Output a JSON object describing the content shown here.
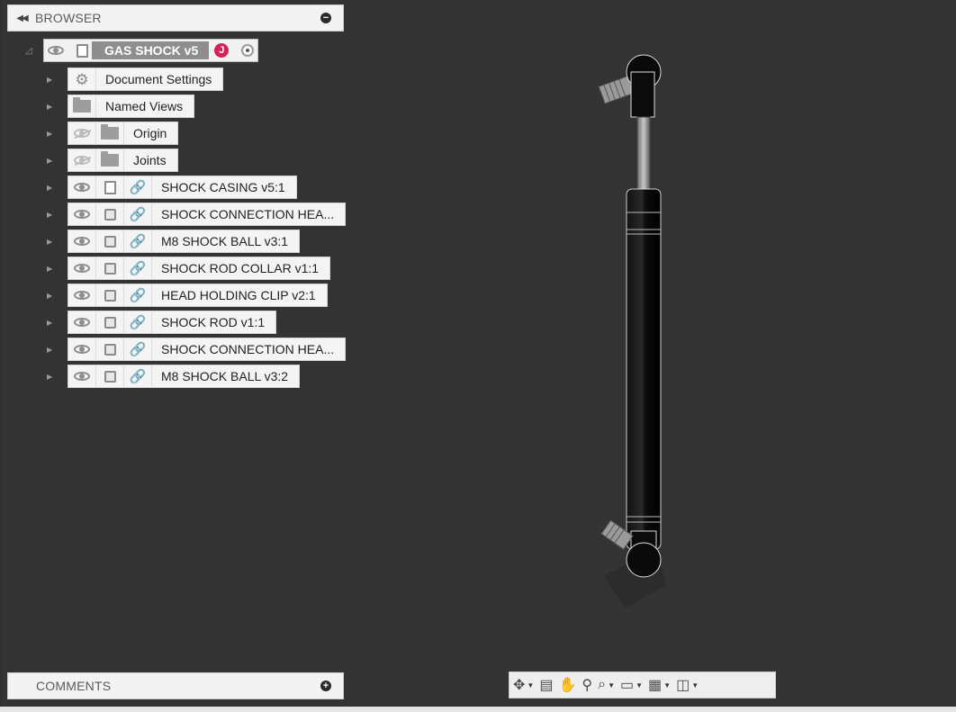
{
  "browser": {
    "title": "BROWSER"
  },
  "comments": {
    "title": "COMMENTS"
  },
  "root": {
    "title": "GAS SHOCK v5",
    "user_initial": "J"
  },
  "tree": [
    {
      "label": "Document Settings",
      "type": "settings"
    },
    {
      "label": "Named Views",
      "type": "folder"
    },
    {
      "label": "Origin",
      "type": "folder-hidden"
    },
    {
      "label": "Joints",
      "type": "folder-hidden"
    },
    {
      "label": "SHOCK CASING v5:1",
      "type": "component-grounded"
    },
    {
      "label": "SHOCK CONNECTION HEA...",
      "type": "component"
    },
    {
      "label": "M8 SHOCK BALL v3:1",
      "type": "component"
    },
    {
      "label": "SHOCK ROD COLLAR v1:1",
      "type": "component"
    },
    {
      "label": "HEAD HOLDING CLIP v2:1",
      "type": "component"
    },
    {
      "label": "SHOCK ROD v1:1",
      "type": "component"
    },
    {
      "label": "SHOCK CONNECTION HEA...",
      "type": "component"
    },
    {
      "label": "M8 SHOCK BALL v3:2",
      "type": "component"
    }
  ],
  "toolbar": {
    "tools": [
      "orbit-icon",
      "look-at-icon",
      "pan-icon",
      "zoom-icon",
      "fit-icon",
      "display-settings-icon",
      "grid-settings-icon",
      "viewports-icon"
    ]
  },
  "colors": {
    "canvas": "#333333",
    "panel": "#f3f3f3",
    "badge": "#d2245b"
  }
}
